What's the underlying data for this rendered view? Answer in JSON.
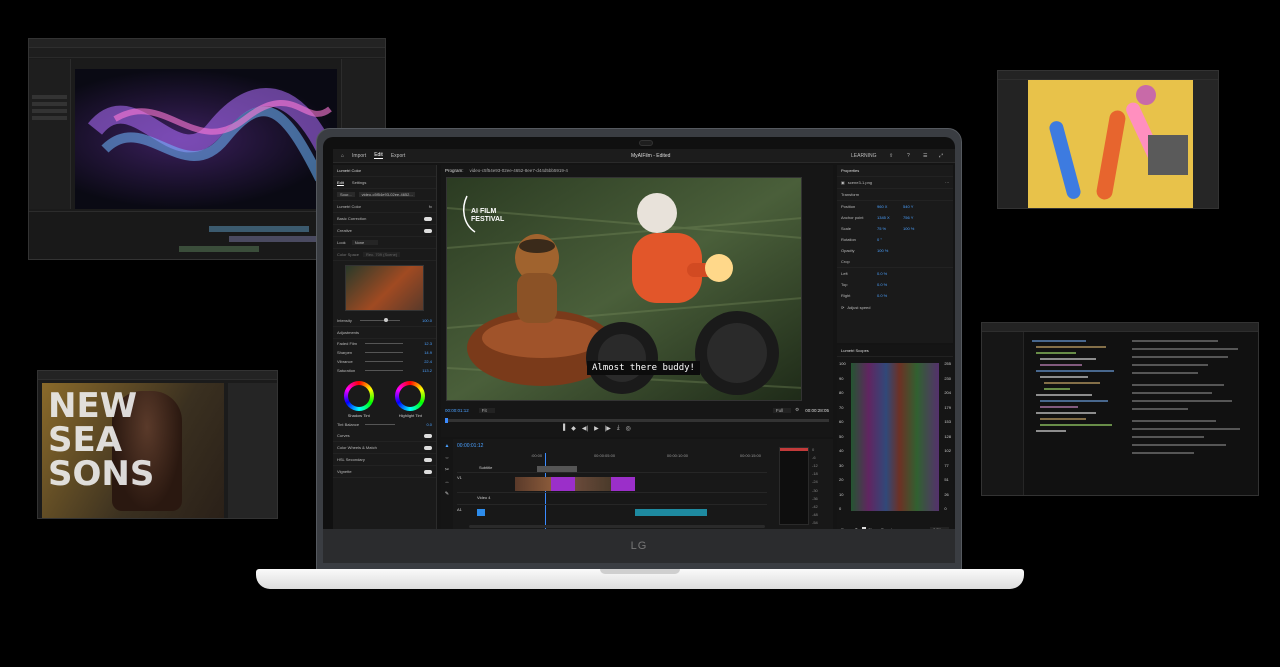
{
  "app": {
    "project_title": "MyAIFilm - Edited",
    "workspace": "LEARNING",
    "nav": [
      "Import",
      "Edit",
      "Export"
    ],
    "active_nav": "Edit"
  },
  "lumetri": {
    "panel_title": "Lumetri Color",
    "tabs": [
      "Edit",
      "Settings"
    ],
    "source_label": "Sour...",
    "clip_name": "video-c5f54e93-02ee-4652...",
    "effect": "Lumetri Color",
    "sections": [
      "Basic Correction",
      "Creative",
      "Curves",
      "Color Wheels & Match",
      "HSL Secondary",
      "Vignette"
    ],
    "look_label": "Look",
    "look_value": "None",
    "color_space_label": "Color Space",
    "color_space_value": "Rec. 709 (Scene)",
    "intensity_label": "Intensity",
    "intensity_value": "100.0",
    "adjustments_label": "Adjustments",
    "adjustments": [
      {
        "label": "Faded Film",
        "value": "12.3"
      },
      {
        "label": "Sharpen",
        "value": "14.9"
      },
      {
        "label": "Vibrance",
        "value": "22.4"
      },
      {
        "label": "Saturation",
        "value": "113.2"
      }
    ],
    "shadow_tint": "Shadow Tint",
    "highlight_tint": "Highlight Tint",
    "tint_balance": "Tint Balance",
    "tint_balance_value": "0.0"
  },
  "program": {
    "label": "Program:",
    "sequence": "video-c5f54e93-02ee-4652-8ee7-d44d5bb5919-4",
    "timecode_in": "00:00:01:12",
    "timecode_out": "00:00:28:05",
    "fit": "Fit",
    "quality": "Full",
    "overlay_title": "AI FILM FESTIVAL",
    "caption": "Almost there buddy!"
  },
  "properties": {
    "title": "Properties",
    "clip": "scene3-1.png",
    "transform_label": "Transform",
    "rows": [
      {
        "label": "Position",
        "v1": "960 X",
        "v2": "540 Y"
      },
      {
        "label": "Anchor point",
        "v1": "1345 X",
        "v2": "756 Y"
      },
      {
        "label": "Scale",
        "v1": "75 %",
        "v2": "100 %"
      },
      {
        "label": "Rotation",
        "v1": "0 °",
        "v2": ""
      },
      {
        "label": "Opacity",
        "v1": "100 %",
        "v2": ""
      }
    ],
    "crop_label": "Crop",
    "crop": [
      {
        "label": "Left",
        "v": "0.0 %"
      },
      {
        "label": "Top",
        "v": "0.0 %"
      },
      {
        "label": "Right",
        "v": "0.0 %"
      }
    ],
    "adjust_speed": "Adjust speed"
  },
  "scopes": {
    "title": "Lumetri Scopes",
    "left_ticks": [
      "100",
      "90",
      "80",
      "70",
      "60",
      "50",
      "40",
      "30",
      "20",
      "10",
      "0"
    ],
    "right_ticks": [
      "255",
      "230",
      "204",
      "179",
      "153",
      "128",
      "102",
      "77",
      "51",
      "26",
      "0"
    ],
    "clamp": "Clamp Signal",
    "bit": "8 Bit",
    "rec": "Rec..."
  },
  "timeline": {
    "timecode": "00:00:01:12",
    "ruler": [
      ":00:00",
      "00:00:05:00",
      "00:00:10:00",
      "00:00:15:00"
    ],
    "tracks": [
      "Subtitle",
      "V1",
      "Video 4",
      "A1"
    ],
    "meter": [
      "0",
      "-6",
      "-12",
      "-18",
      "-24",
      "-30",
      "-36",
      "-42",
      "-48",
      "-54"
    ]
  },
  "photoshop_overlay": [
    "NEW",
    "SEA",
    "SONS"
  ],
  "laptop_logo": "LG",
  "colors": {
    "accent_blue": "#2d8ceb",
    "clip_purple": "#9b2fc9",
    "clip_teal": "#1e8aa0",
    "playhead": "#3b8bff"
  }
}
